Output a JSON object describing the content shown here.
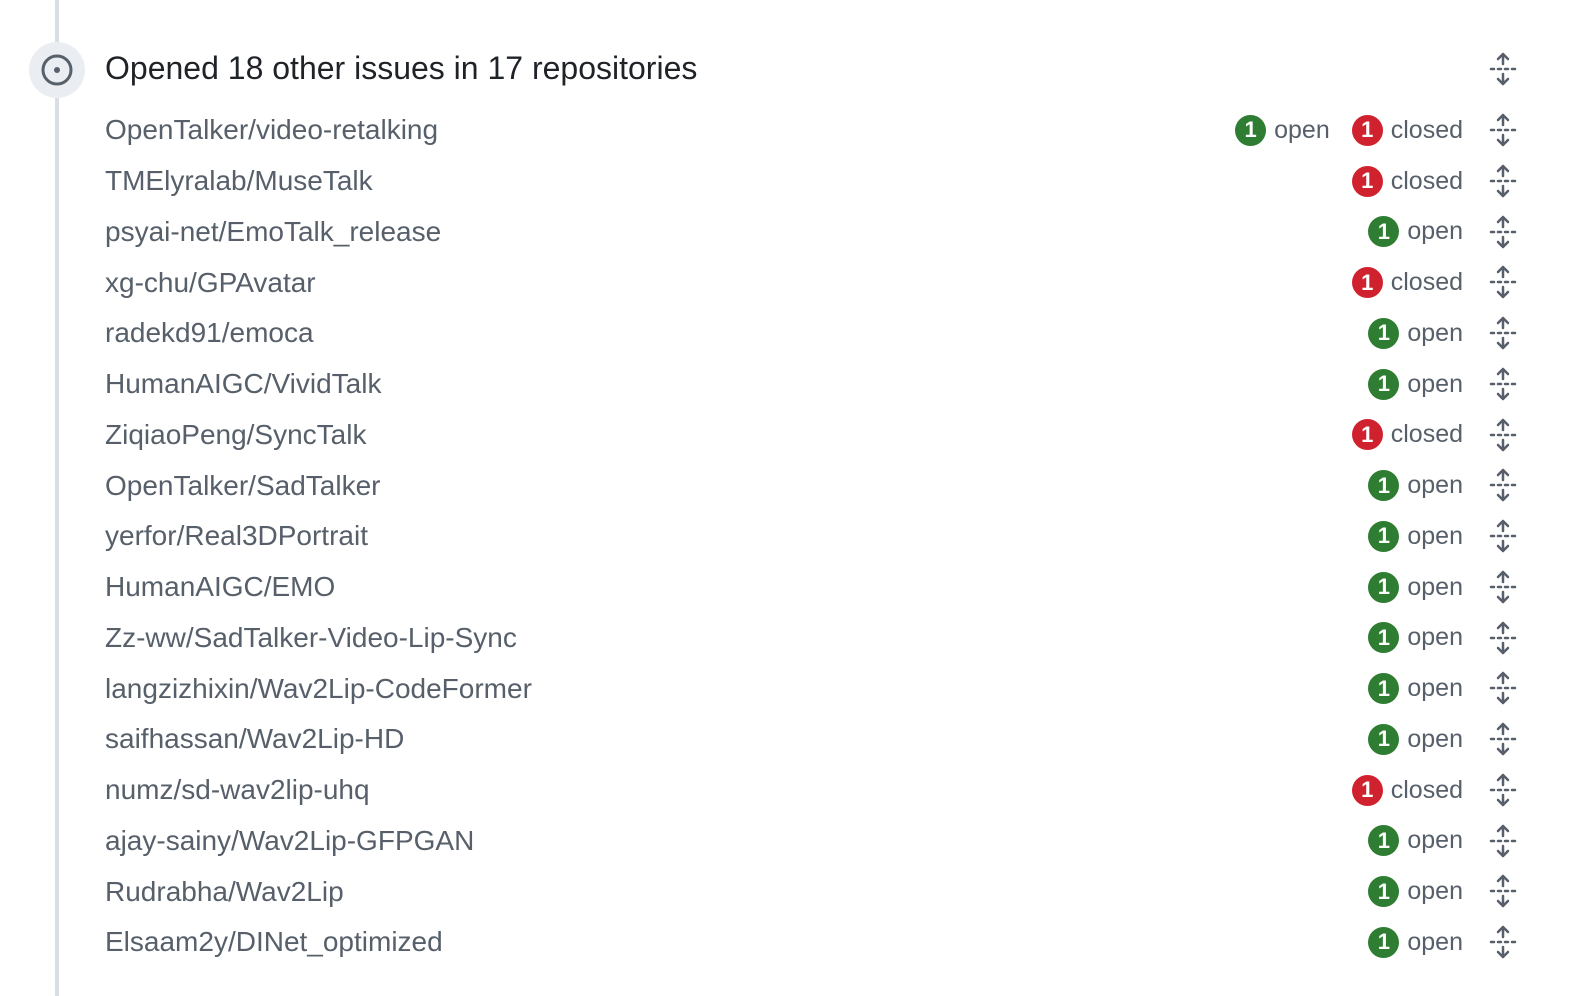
{
  "event": {
    "icon": "issue-opened-icon",
    "title": "Opened 18 other issues in 17 repositories",
    "collapse_icon": "fold-icon"
  },
  "colors": {
    "open": "#2e7d32",
    "closed": "#cf222e",
    "text_muted": "#57606a",
    "timeline": "#d8dee4"
  },
  "repos": [
    {
      "name": "OpenTalker/video-retalking",
      "open": "1",
      "open_label": "open",
      "closed": "1",
      "closed_label": "closed"
    },
    {
      "name": "TMElyralab/MuseTalk",
      "closed": "1",
      "closed_label": "closed"
    },
    {
      "name": "psyai-net/EmoTalk_release",
      "open": "1",
      "open_label": "open"
    },
    {
      "name": "xg-chu/GPAvatar",
      "closed": "1",
      "closed_label": "closed"
    },
    {
      "name": "radekd91/emoca",
      "open": "1",
      "open_label": "open"
    },
    {
      "name": "HumanAIGC/VividTalk",
      "open": "1",
      "open_label": "open"
    },
    {
      "name": "ZiqiaoPeng/SyncTalk",
      "closed": "1",
      "closed_label": "closed"
    },
    {
      "name": "OpenTalker/SadTalker",
      "open": "1",
      "open_label": "open"
    },
    {
      "name": "yerfor/Real3DPortrait",
      "open": "1",
      "open_label": "open"
    },
    {
      "name": "HumanAIGC/EMO",
      "open": "1",
      "open_label": "open"
    },
    {
      "name": "Zz-ww/SadTalker-Video-Lip-Sync",
      "open": "1",
      "open_label": "open"
    },
    {
      "name": "langzizhixin/Wav2Lip-CodeFormer",
      "open": "1",
      "open_label": "open"
    },
    {
      "name": "saifhassan/Wav2Lip-HD",
      "open": "1",
      "open_label": "open"
    },
    {
      "name": "numz/sd-wav2lip-uhq",
      "closed": "1",
      "closed_label": "closed"
    },
    {
      "name": "ajay-sainy/Wav2Lip-GFPGAN",
      "open": "1",
      "open_label": "open"
    },
    {
      "name": "Rudrabha/Wav2Lip",
      "open": "1",
      "open_label": "open"
    },
    {
      "name": "Elsaam2y/DINet_optimized",
      "open": "1",
      "open_label": "open"
    }
  ]
}
